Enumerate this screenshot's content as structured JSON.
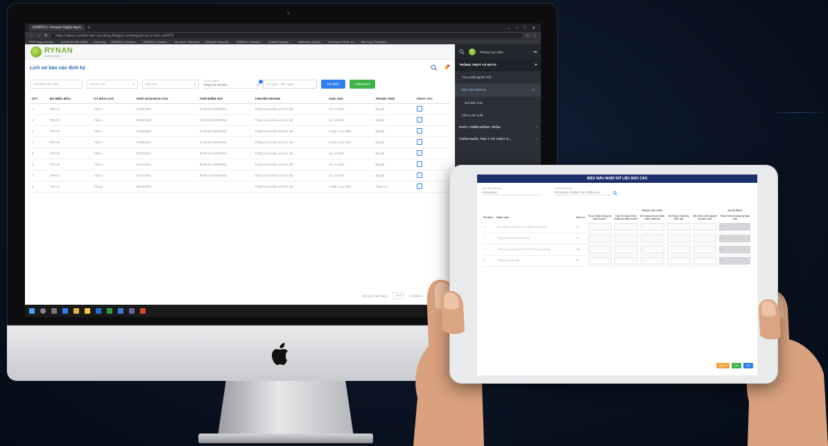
{
  "browser": {
    "tab_title": "VEMPES | Vietnam Digital Agric...",
    "url": "https://rdpvn.com/lich-bao-cao-dong-thoigian-va-thong-tin-ac-vn-bao-cao/673",
    "bookmarks": [
      "POP Image Annota...",
      "ASSISTATURE SEED",
      "Cao trung",
      "VEMPES | Vietnam...",
      "VEMPES | Vietnam...",
      "My Drive - Microsoft",
      "Thống kê tổng hợp...",
      "VEMPES | Vietnam...",
      "Untitled Diagram -...",
      "Attributes | jQuery...",
      "Kế hoạch COVID-19...",
      "Bird Copy Templates..."
    ]
  },
  "app": {
    "logo_text": "RYNAN",
    "logo_sub": "SMART FARMING",
    "page_title": "Lịch sử báo cáo định kỳ",
    "notification_count": "1"
  },
  "filters": {
    "template_placeholder": "Tìm kiếm tên mẫu...",
    "period_placeholder": "Kỳ báo cáo",
    "region_placeholder": "Khu vực",
    "industry_label": "Chuyên ngành",
    "industry_value": "Trồng trọt và bảo...",
    "date_placeholder": "Từ ngày - đến ngày",
    "search_button": "Tìm kiếm",
    "export_button": "Xuất Excel"
  },
  "table": {
    "headers": [
      "STT",
      "MÃ BIỂU MẪU",
      "KỲ BÁO CÁO",
      "THỜI GIAN BÁO CÁO",
      "THỜI ĐIỂM GỬI",
      "CHUYÊN NGÀNH",
      "KHU VỰC",
      "TRẠNG THÁI",
      "THAO TÁC"
    ],
    "rows": [
      [
        "1",
        "TNR-01",
        "Tuần 1",
        "01/08/2022",
        "10:18:23 04/08/2022",
        "Trồng trọt và bảo vệ thực vật",
        "Sở An Bình",
        "Đã gửi"
      ],
      [
        "2",
        "TNR-02",
        "Tuần 1",
        "01/08/2022",
        "10:22:10 04/08/2022",
        "Trồng trọt và bảo vệ thực vật",
        "Sở An Bình",
        "Đã gửi"
      ],
      [
        "3",
        "TNR-01",
        "Tuần 1",
        "01/08/2022",
        "10:26:05 04/08/2022",
        "Trồng trọt và bảo vệ thực vật",
        "Huyện Cao Lãnh",
        "Đã gửi"
      ],
      [
        "4",
        "TNR-02",
        "Tuần 2",
        "01/08/2022",
        "10:30:54 04/08/2022",
        "Trồng trọt và bảo vệ thực vật",
        "Huyện Cao Lãnh",
        "Đã gửi"
      ],
      [
        "5",
        "TNR-01",
        "Tuần 1",
        "01/07/2022",
        "08:09:44 04/08/2022",
        "Trồng trọt và bảo vệ thực vật",
        "Sở An Bình",
        "Đã gửi"
      ],
      [
        "6",
        "TNR-02",
        "Tuần 1",
        "01/07/2022",
        "08:09:55 04/08/2022",
        "Trồng trọt và bảo vệ thực vật",
        "Sở An Bình",
        "Đã gửi"
      ],
      [
        "7",
        "TNR-01",
        "Tuần 1",
        "01/07/2022",
        "09:05:41 05/08/2022",
        "Trồng trọt và bảo vệ thực vật",
        "Sở An Bình",
        "Đã gửi"
      ],
      [
        "8",
        "TNR-01",
        "Tháng",
        "08/08/2022",
        "",
        "Trồng trọt và bảo vệ thực vật",
        "Huyện Cao Lãnh",
        "Nháp lưu"
      ]
    ],
    "pager_label": "Số mục mỗi trang",
    "page_size": "10",
    "page_range": "1-8 trên 8"
  },
  "sidebar": {
    "user_name": "Phòng Cao Lãnh",
    "sections": [
      {
        "label": "TRỒNG TRỌT VÀ BVTV",
        "active": true
      },
      {
        "label": "PHÁT TRIỂN NÔNG THÔN",
        "active": false
      },
      {
        "label": "CHĂN NUÔI, THÚ Y VÀ THỦY S...",
        "active": false
      }
    ],
    "items": [
      {
        "label": "Truy Xuất Nguồn Gốc",
        "active": false
      },
      {
        "label": "Báo Cáo Định Kỳ",
        "active": true
      },
      {
        "label": "Gửi Báo Cáo",
        "active": false
      },
      {
        "label": "Vật tư sản xuất",
        "active": false
      }
    ]
  },
  "tablet": {
    "header": "BIỂU MẪU NHẬP DỮ LIỆU BÁO CÁO",
    "field1_label": "Khu vực báo cáo",
    "field1_value": "Sở An Bình",
    "field2_label": "Chỉ tiêu báo cáo",
    "field2_value": "KẾ HOẠCH TRỒNG CÂY ĐIỀU (C/V...",
    "group1": "Huyện Cao Lãnh",
    "group2": "Sở An Bình",
    "col_headers": [
      "Số hiệu",
      "Danh mục",
      "Đơn vị",
      "Thực hiện cùng kỳ năm trước",
      "Lũy kế thực hiện cùng kỳ năm trước",
      "Kế hoạch thực hiện năm hiện tại",
      "Ghi thực hiện kỳ hiện tại",
      "Ghi tiến trình quyết kỳ báo cáo",
      "Thực hiện trong kỳ báo cáo"
    ],
    "rows": [
      {
        "code": "A",
        "name": "KẾ HOẠCH TRỒNG CÂY ĐIỀU C/V ĐƠN",
        "unit": "ha",
        "value": "0"
      },
      {
        "code": "1",
        "name": "Tổng diện tích đã trồng mới",
        "unit": "ha",
        "value": "0"
      },
      {
        "code": "2",
        "name": "Tổng số cây trồng được hỗ trợ từ trung ương",
        "unit": "cây",
        "value": "0"
      },
      {
        "code": "3",
        "name": "Tổng cây phát triển",
        "unit": "ha",
        "value": "0"
      }
    ],
    "btn_cancel": "Hủy bỏ",
    "btn_save": "Lưu",
    "btn_send": "Gửi"
  }
}
